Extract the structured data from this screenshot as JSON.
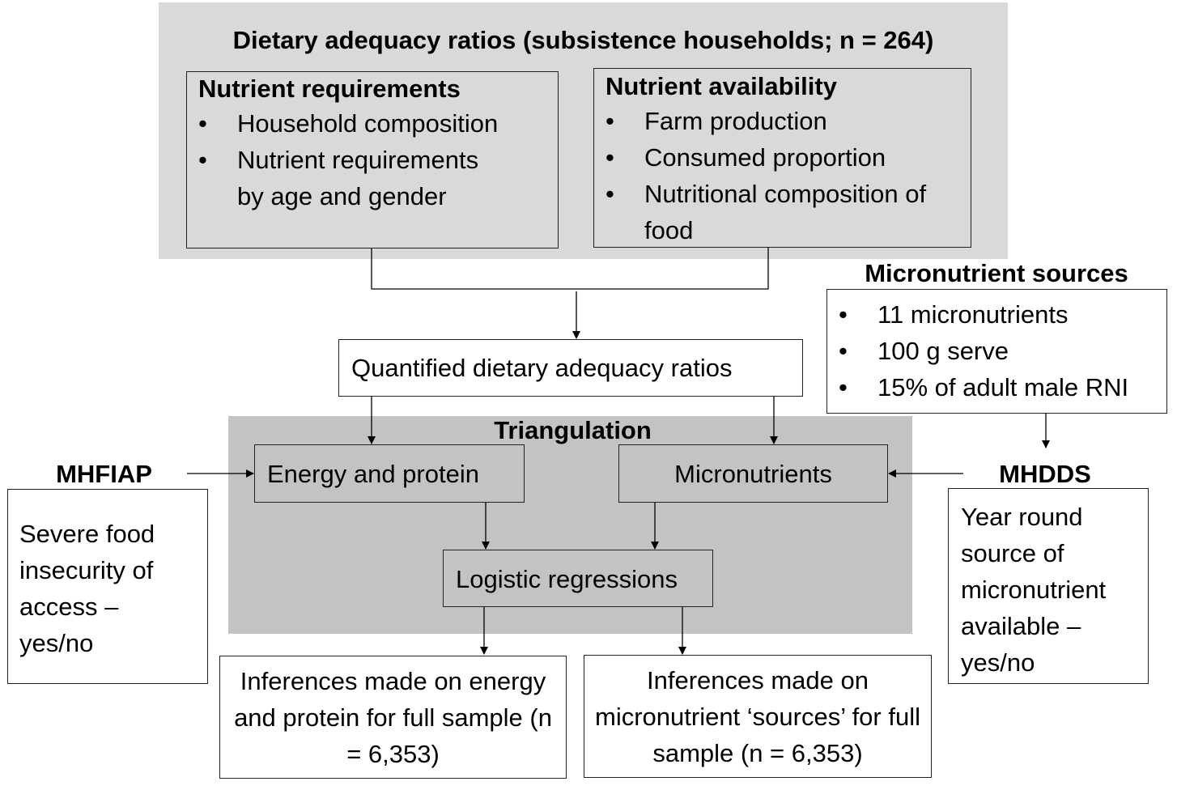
{
  "top_panel": {
    "title": "Dietary adequacy ratios (subsistence households; n = 264)",
    "requirements": {
      "heading": "Nutrient requirements",
      "items": [
        "Household composition",
        "Nutrient requirements by age and gender"
      ]
    },
    "availability": {
      "heading": "Nutrient availability",
      "items": [
        "Farm production",
        "Consumed proportion",
        "Nutritional composition of food"
      ]
    }
  },
  "micronutrient_sources": {
    "heading": "Micronutrient sources",
    "items": [
      "11 micronutrients",
      "100 g serve",
      "15% of adult male RNI"
    ]
  },
  "quantified": "Quantified dietary adequacy ratios",
  "triangulation": {
    "title": "Triangulation",
    "energy_protein": "Energy and protein",
    "micronutrients": "Micronutrients",
    "logistic": "Logistic regressions"
  },
  "mhfiap": {
    "heading": "MHFIAP",
    "text": "Severe food insecurity of access – yes/no"
  },
  "mhdds": {
    "heading": "MHDDS",
    "text": "Year round source of micronutrient available – yes/no"
  },
  "inference_left": "Inferences made on energy and protein for full sample (n = 6,353)",
  "inference_right": "Inferences made on micronutrient ‘sources’ for full sample (n = 6,353)"
}
